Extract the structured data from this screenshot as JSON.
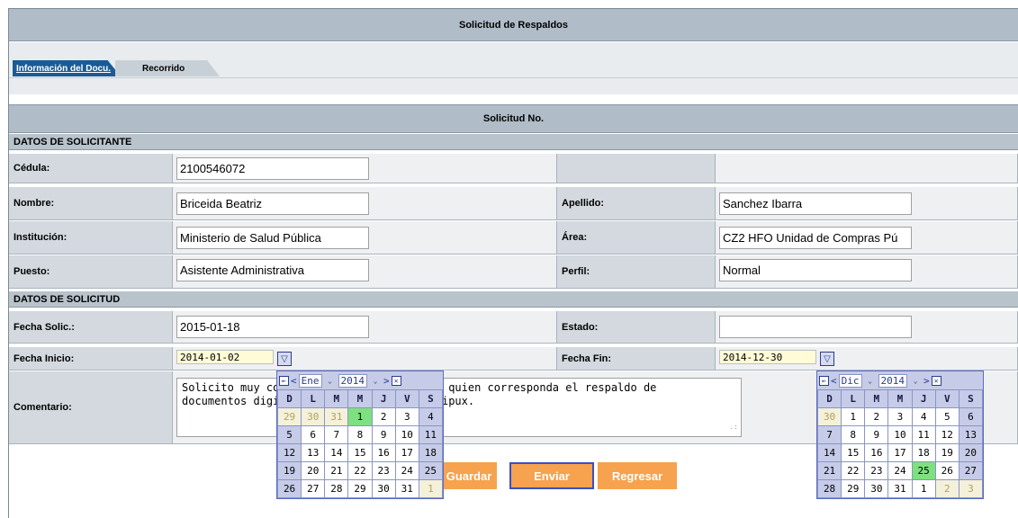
{
  "header": {
    "title": "Solicitud de Respaldos"
  },
  "tabs": [
    {
      "label": "Información del Docu."
    },
    {
      "label": "Recorrido"
    }
  ],
  "subheader": {
    "title": "Solicitud No."
  },
  "sections": {
    "solicitante": "DATOS DE SOLICITANTE",
    "solicitud": "DATOS DE SOLICITUD"
  },
  "fields": {
    "cedula": {
      "label": "Cédula:",
      "value": "2100546072"
    },
    "nombre": {
      "label": "Nombre:",
      "value": "Briceida Beatriz"
    },
    "apellido": {
      "label": "Apellido:",
      "value": "Sanchez Ibarra"
    },
    "institucion": {
      "label": "Institución:",
      "value": "Ministerio de Salud Pública"
    },
    "area": {
      "label": "Área:",
      "value": "CZ2 HFO Unidad de Compras Pú"
    },
    "puesto": {
      "label": "Puesto:",
      "value": "Asistente Administrativa"
    },
    "perfil": {
      "label": "Perfil:",
      "value": "Normal"
    },
    "fecha_solic": {
      "label": "Fecha Solic.:",
      "value": "2015-01-18"
    },
    "estado": {
      "label": "Estado:",
      "value": ""
    },
    "fecha_inicio": {
      "label": "Fecha Inicio:",
      "value": "2014-01-02"
    },
    "fecha_fin": {
      "label": "Fecha Fin:",
      "value": "2014-12-30"
    },
    "comentario": {
      "label": "Comentario:",
      "value": "Solicito muy comedidamente se autorice a quien corresponda el respaldo de\ndocumentos digitalizados a través del Quipux."
    }
  },
  "buttons": {
    "guardar": "Guardar",
    "enviar": "Enviar",
    "regresar": "Regresar"
  },
  "calendar_left": {
    "month": "Ene",
    "year": "2014",
    "day_headers": [
      "D",
      "L",
      "M",
      "M",
      "J",
      "V",
      "S"
    ],
    "days": [
      "29",
      "30",
      "31",
      "1",
      "2",
      "3",
      "4",
      "5",
      "6",
      "7",
      "8",
      "9",
      "10",
      "11",
      "12",
      "13",
      "14",
      "15",
      "16",
      "17",
      "18",
      "19",
      "20",
      "21",
      "22",
      "23",
      "24",
      "25",
      "26",
      "27",
      "28",
      "29",
      "30",
      "31",
      "1"
    ]
  },
  "calendar_right": {
    "month": "Dic",
    "year": "2014",
    "day_headers": [
      "D",
      "L",
      "M",
      "M",
      "J",
      "V",
      "S"
    ],
    "days": [
      "30",
      "1",
      "2",
      "3",
      "4",
      "5",
      "6",
      "7",
      "8",
      "9",
      "10",
      "11",
      "12",
      "13",
      "14",
      "15",
      "16",
      "17",
      "18",
      "19",
      "20",
      "21",
      "22",
      "23",
      "24",
      "25",
      "26",
      "27",
      "28",
      "29",
      "30",
      "31",
      "1",
      "2",
      "3"
    ]
  }
}
